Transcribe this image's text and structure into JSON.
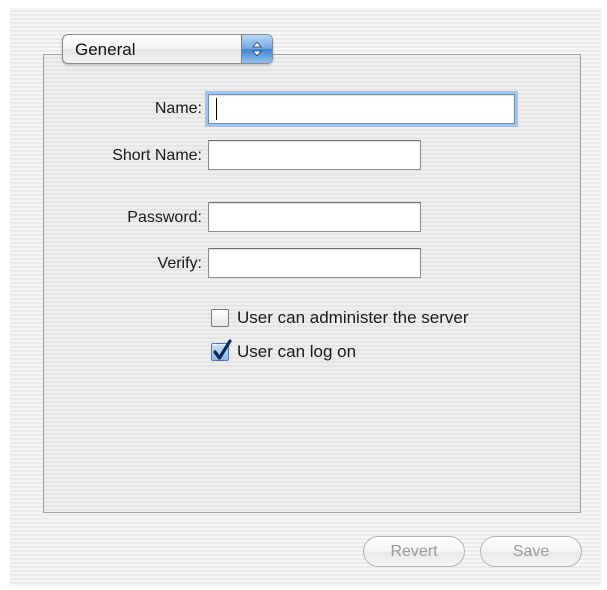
{
  "popup": {
    "selected": "General"
  },
  "form": {
    "name_label": "Name:",
    "name_value": "",
    "short_name_label": "Short Name:",
    "short_name_value": "",
    "password_label": "Password:",
    "password_value": "",
    "verify_label": "Verify:",
    "verify_value": ""
  },
  "options": [
    {
      "label": "User can administer the server",
      "checked": false
    },
    {
      "label": "User can log on",
      "checked": true
    }
  ],
  "buttons": {
    "revert": "Revert",
    "save": "Save",
    "revert_enabled": false,
    "save_enabled": false
  },
  "colors": {
    "accent": "#3f84d2",
    "focus_ring": "#a3c5ec",
    "disabled_text": "#9a9a9a"
  },
  "icons": {
    "popup": "up-down-arrows-icon",
    "checkmark": "checkmark-icon"
  }
}
